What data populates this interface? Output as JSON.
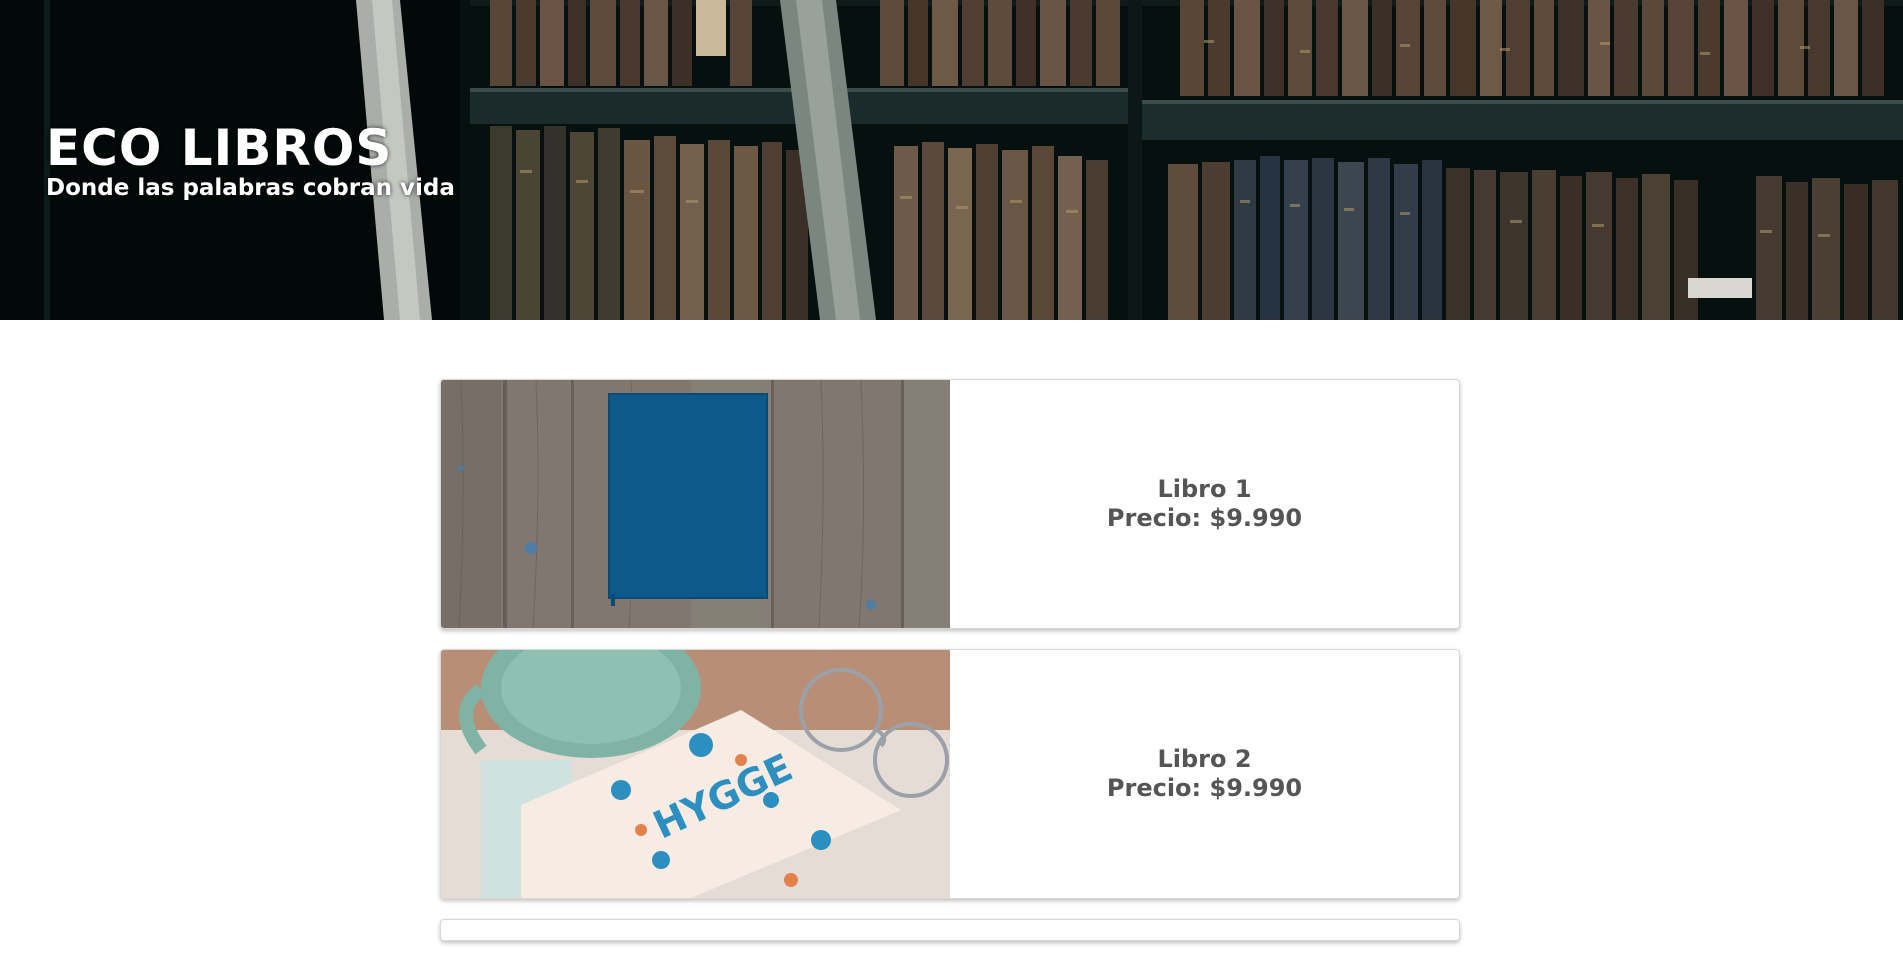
{
  "hero": {
    "title": "ECO LIBROS",
    "subtitle": "Donde las palabras cobran vida",
    "image": "library-bookshelf-photo"
  },
  "books": [
    {
      "title": "Libro 1",
      "price": "Precio: $9.990",
      "image": "blue-notebook-on-wood-photo"
    },
    {
      "title": "Libro 2",
      "price": "Precio: $9.990",
      "image": "hygge-book-with-mug-and-glasses-photo"
    }
  ],
  "colors": {
    "card_text": "#555555",
    "hero_text": "#ffffff",
    "page_background": "#ffffff"
  }
}
